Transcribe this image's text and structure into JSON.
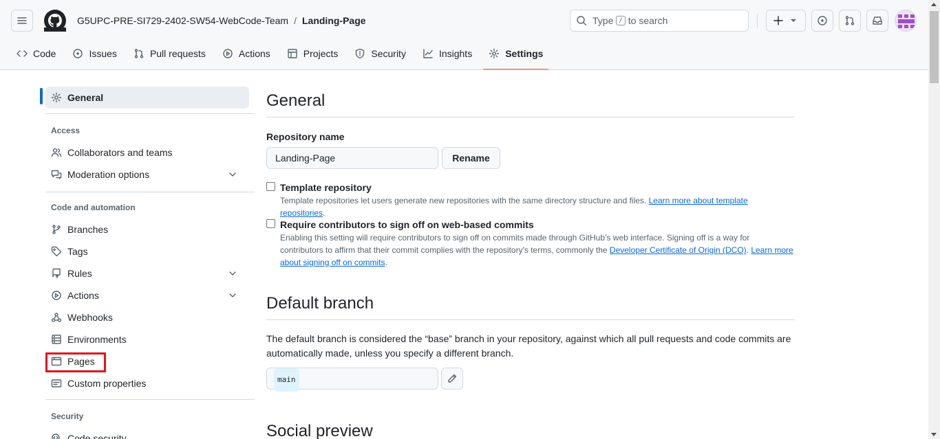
{
  "header": {
    "owner": "G5UPC-PRE-SI729-2402-SW54-WebCode-Team",
    "separator": "/",
    "repo": "Landing-Page",
    "search_prefix": "Type",
    "search_key": "/",
    "search_suffix": "to search"
  },
  "tabs": [
    {
      "label": "Code",
      "icon": "code-icon"
    },
    {
      "label": "Issues",
      "icon": "issue-icon"
    },
    {
      "label": "Pull requests",
      "icon": "pull-request-icon"
    },
    {
      "label": "Actions",
      "icon": "play-icon"
    },
    {
      "label": "Projects",
      "icon": "table-icon"
    },
    {
      "label": "Security",
      "icon": "shield-icon"
    },
    {
      "label": "Insights",
      "icon": "graph-icon"
    },
    {
      "label": "Settings",
      "icon": "gear-icon",
      "selected": true
    }
  ],
  "sidebar": {
    "general": "General",
    "access_heading": "Access",
    "collaborators": "Collaborators and teams",
    "moderation": "Moderation options",
    "code_heading": "Code and automation",
    "branches": "Branches",
    "tags": "Tags",
    "rules": "Rules",
    "actions": "Actions",
    "webhooks": "Webhooks",
    "environments": "Environments",
    "pages": "Pages",
    "custom_properties": "Custom properties",
    "security_heading": "Security",
    "code_security": "Code security"
  },
  "main": {
    "title": "General",
    "repo_name_label": "Repository name",
    "repo_name_value": "Landing-Page",
    "rename_button": "Rename",
    "template_title": "Template repository",
    "template_desc": "Template repositories let users generate new repositories with the same directory structure and files.",
    "template_link": "Learn more about template repositories",
    "signoff_title": "Require contributors to sign off on web-based commits",
    "signoff_desc1": "Enabling this setting will require contributors to sign off on commits made through GitHub’s web interface. Signing off is a way for contributors to affirm that their commit complies with the repository's terms, commonly the",
    "signoff_link1": "Developer Certificate of Origin (DCO)",
    "signoff_link2": "Learn more about signing off on commits",
    "default_branch_title": "Default branch",
    "default_branch_desc": "The default branch is considered the “base” branch in your repository, against which all pull requests and code commits are automatically made, unless you specify a different branch.",
    "default_branch_value": "main",
    "social_preview_title": "Social preview"
  },
  "colors": {
    "accent": "#0969da",
    "tab_underline": "#fd8c73",
    "highlight_box": "#e0141e"
  }
}
